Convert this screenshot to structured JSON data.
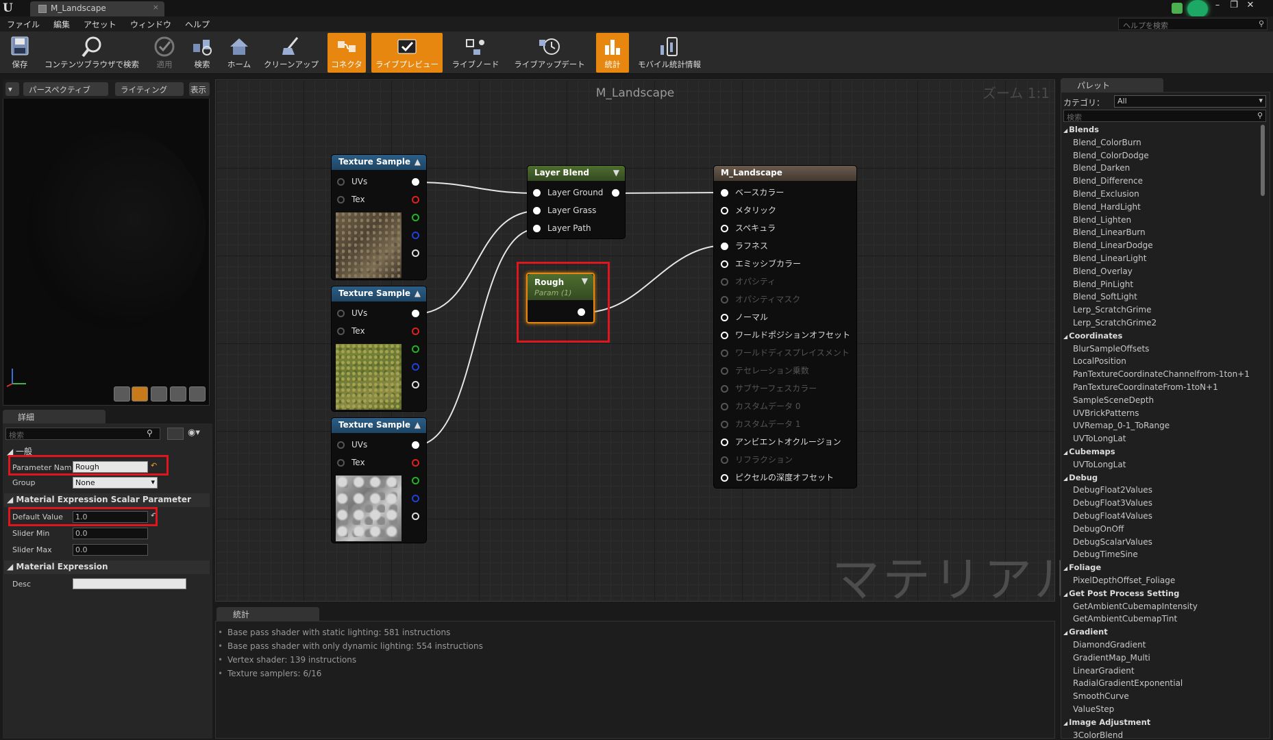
{
  "window": {
    "tab_title": "M_Landscape",
    "close_glyph": "×",
    "help_search_placeholder": "ヘルプを検索"
  },
  "menu": [
    "ファイル",
    "編集",
    "アセット",
    "ウィンドウ",
    "ヘルプ"
  ],
  "toolbar": [
    {
      "label": "保存",
      "icon": "save-icon"
    },
    {
      "label": "コンテンツブラウザで検索",
      "icon": "content-browser-search-icon"
    },
    {
      "label": "適用",
      "icon": "apply-icon"
    },
    {
      "label": "検索",
      "icon": "search-icon"
    },
    {
      "label": "ホーム",
      "icon": "home-icon"
    },
    {
      "label": "クリーンアップ",
      "icon": "cleanup-icon"
    },
    {
      "label": "コネクタ",
      "icon": "connector-icon"
    },
    {
      "label": "ライブプレビュー",
      "icon": "live-preview-icon"
    },
    {
      "label": "ライブノード",
      "icon": "live-nodes-icon"
    },
    {
      "label": "ライブアップデート",
      "icon": "live-update-icon"
    },
    {
      "label": "統計",
      "icon": "stats-icon"
    },
    {
      "label": "モバイル統計情報",
      "icon": "mobile-stats-icon"
    }
  ],
  "viewport": {
    "perspective": "パースペクティブ",
    "lighting": "ライティング",
    "show": "表示"
  },
  "details": {
    "tab": "詳細",
    "search_placeholder": "検索",
    "general": "一般",
    "param_name_label": "Parameter Name",
    "param_name_value": "Rough",
    "group_label": "Group",
    "group_value": "None",
    "scalar_section": "Material Expression Scalar Parameter",
    "default_label": "Default Value",
    "default_value": "1.0",
    "slider_min_label": "Slider Min",
    "slider_min_value": "0.0",
    "slider_max_label": "Slider Max",
    "slider_max_value": "0.0",
    "expr_section": "Material Expression",
    "desc_label": "Desc",
    "desc_value": ""
  },
  "graph": {
    "title": "M_Landscape",
    "zoom": "ズーム 1:1",
    "watermark": "マテリアル",
    "texture_sample": {
      "title": "Texture Sample",
      "uvs": "UVs",
      "tex": "Tex"
    },
    "layer_blend": {
      "title": "Layer Blend",
      "inputs": [
        "Layer Ground",
        "Layer Grass",
        "Layer Path"
      ]
    },
    "rough": {
      "title": "Rough",
      "subtitle": "Param (1)"
    },
    "result": {
      "title": "M_Landscape",
      "inputs": [
        {
          "label": "ベースカラー",
          "active": true
        },
        {
          "label": "メタリック",
          "active": true
        },
        {
          "label": "スペキュラ",
          "active": true
        },
        {
          "label": "ラフネス",
          "active": true
        },
        {
          "label": "エミッシブカラー",
          "active": true
        },
        {
          "label": "オパシティ",
          "active": false
        },
        {
          "label": "オパシティマスク",
          "active": false
        },
        {
          "label": "ノーマル",
          "active": true
        },
        {
          "label": "ワールドポジションオフセット",
          "active": true
        },
        {
          "label": "ワールドディスプレイスメント",
          "active": false
        },
        {
          "label": "テセレーション乗数",
          "active": false
        },
        {
          "label": "サブサーフェスカラー",
          "active": false
        },
        {
          "label": "カスタムデータ 0",
          "active": false
        },
        {
          "label": "カスタムデータ 1",
          "active": false
        },
        {
          "label": "アンビエントオクルージョン",
          "active": true
        },
        {
          "label": "リフラクション",
          "active": false
        },
        {
          "label": "ピクセルの深度オフセット",
          "active": true
        }
      ]
    }
  },
  "stats": {
    "tab": "統計",
    "lines": [
      "Base pass shader with static lighting: 581 instructions",
      "Base pass shader with only dynamic lighting: 554 instructions",
      "Vertex shader: 139 instructions",
      "Texture samplers: 6/16"
    ]
  },
  "palette": {
    "tab": "パレット",
    "category_label": "カテゴリ：",
    "category_value": "All",
    "search_placeholder": "検索",
    "groups": [
      {
        "name": "Blends",
        "items": [
          "Blend_ColorBurn",
          "Blend_ColorDodge",
          "Blend_Darken",
          "Blend_Difference",
          "Blend_Exclusion",
          "Blend_HardLight",
          "Blend_Lighten",
          "Blend_LinearBurn",
          "Blend_LinearDodge",
          "Blend_LinearLight",
          "Blend_Overlay",
          "Blend_PinLight",
          "Blend_SoftLight",
          "Lerp_ScratchGrime",
          "Lerp_ScratchGrime2"
        ]
      },
      {
        "name": "Coordinates",
        "items": [
          "BlurSampleOffsets",
          "LocalPosition",
          "PanTextureCoordinateChannelfrom-1ton+1",
          "PanTextureCoordinateFrom-1toN+1",
          "SampleSceneDepth",
          "UVBrickPatterns",
          "UVRemap_0-1_ToRange",
          "UVToLongLat"
        ]
      },
      {
        "name": "Cubemaps",
        "items": [
          "UVToLongLat"
        ]
      },
      {
        "name": "Debug",
        "items": [
          "DebugFloat2Values",
          "DebugFloat3Values",
          "DebugFloat4Values",
          "DebugOnOff",
          "DebugScalarValues",
          "DebugTimeSine"
        ]
      },
      {
        "name": "Foliage",
        "items": [
          "PixelDepthOffset_Foliage"
        ]
      },
      {
        "name": "Get Post Process Setting",
        "items": [
          "GetAmbientCubemapIntensity",
          "GetAmbientCubemapTint"
        ]
      },
      {
        "name": "Gradient",
        "items": [
          "DiamondGradient",
          "GradientMap_Multi",
          "LinearGradient",
          "RadialGradientExponential",
          "SmoothCurve",
          "ValueStep"
        ]
      },
      {
        "name": "Image Adjustment",
        "items": [
          "3ColorBlend"
        ]
      }
    ]
  },
  "colors": {
    "accent_orange": "#e8870f",
    "highlight_red": "#e0161f",
    "node_blue": "#2b5e86",
    "node_green": "#4e6e2e"
  }
}
